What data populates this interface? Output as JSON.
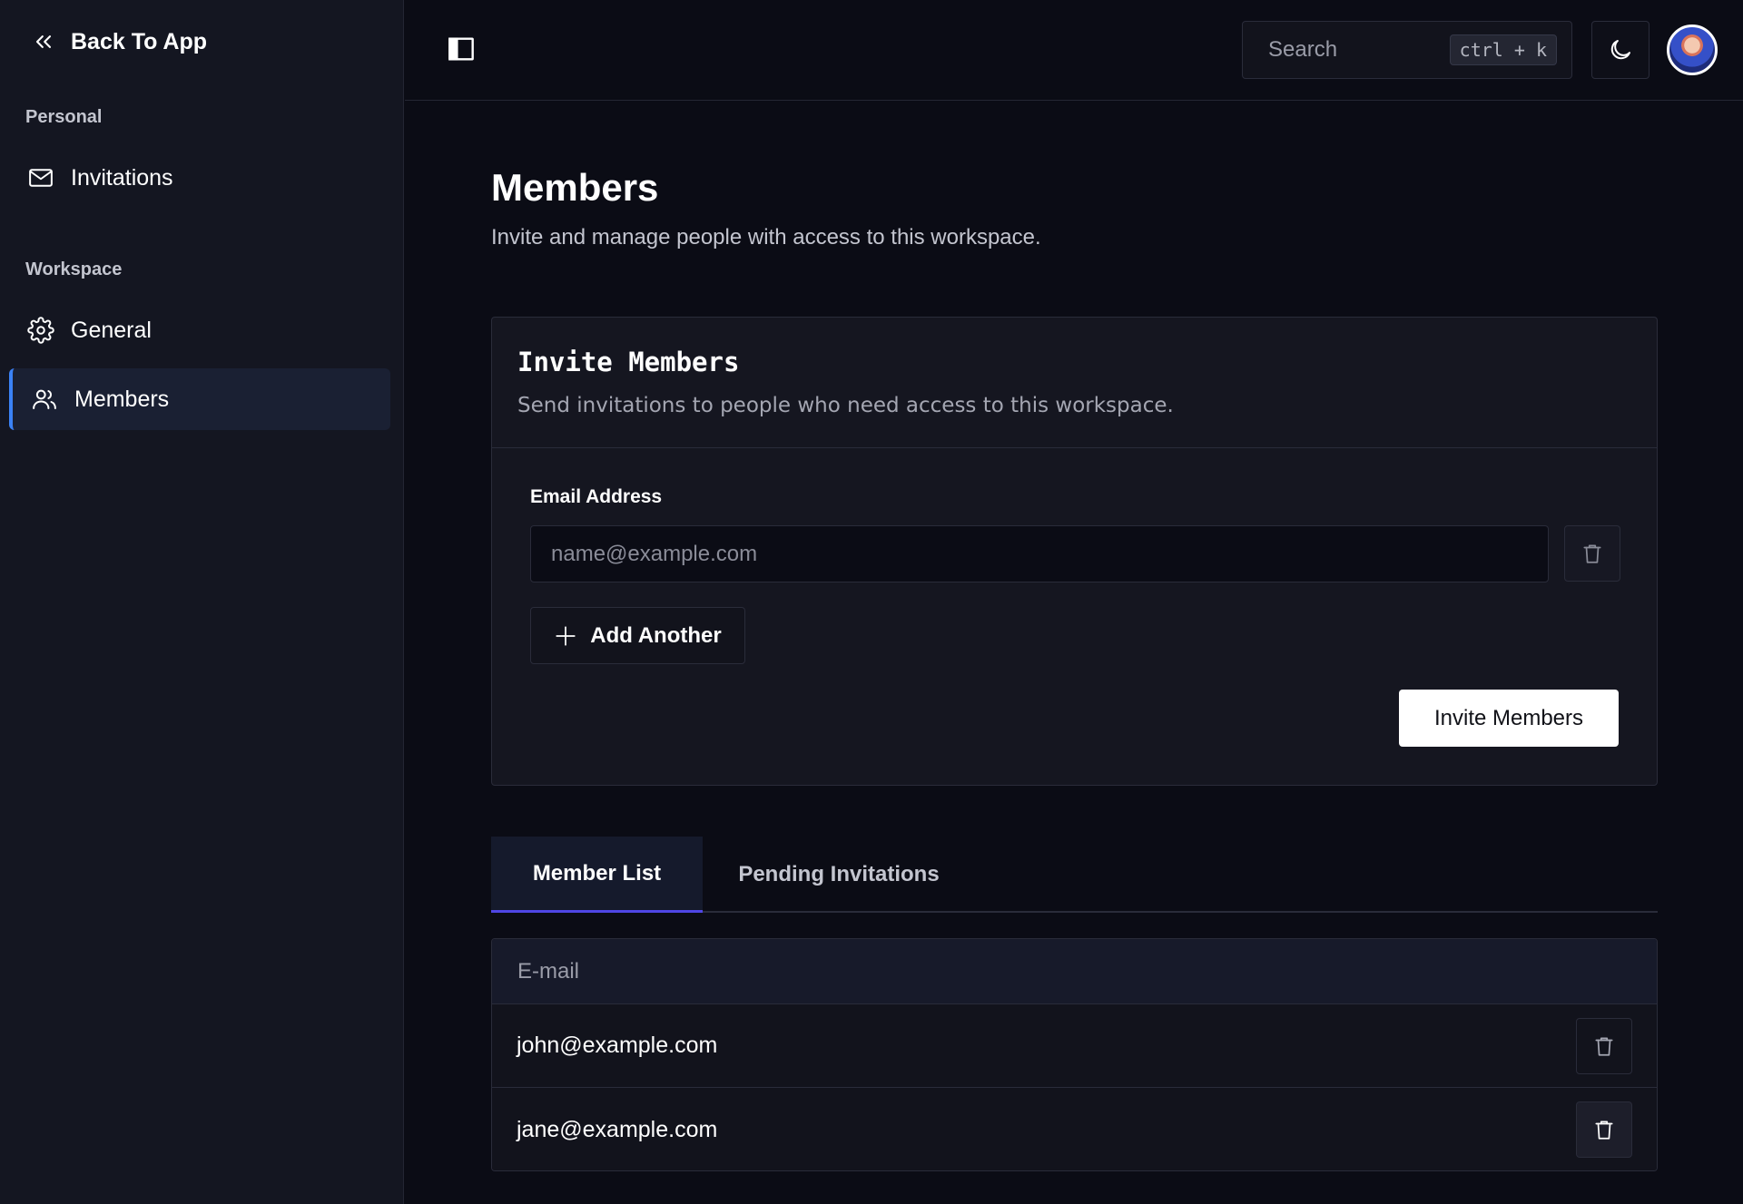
{
  "sidebar": {
    "back_label": "Back To App",
    "sections": [
      {
        "label": "Personal",
        "items": [
          {
            "label": "Invitations",
            "icon": "mail-icon"
          }
        ]
      },
      {
        "label": "Workspace",
        "items": [
          {
            "label": "General",
            "icon": "gear-icon"
          },
          {
            "label": "Members",
            "icon": "users-icon",
            "active": true
          }
        ]
      }
    ]
  },
  "topbar": {
    "search_label": "Search",
    "shortcut": "ctrl + k",
    "theme_icon": "moon-icon",
    "avatar": "user-avatar"
  },
  "page": {
    "title": "Members",
    "subtitle": "Invite and manage people with access to this workspace."
  },
  "invite": {
    "title": "Invite Members",
    "description": "Send invitations to people who need access to this workspace.",
    "field_label": "Email Address",
    "email_placeholder": "name@example.com",
    "email_value": "",
    "add_label": "Add Another",
    "submit_label": "Invite Members"
  },
  "tabs": [
    {
      "label": "Member List",
      "active": true
    },
    {
      "label": "Pending Invitations",
      "active": false
    }
  ],
  "table": {
    "header": "E-mail",
    "rows": [
      {
        "email": "john@example.com"
      },
      {
        "email": "jane@example.com"
      }
    ]
  },
  "colors": {
    "background": "#0b0c15",
    "sidebar": "#141621",
    "accent": "#3b82f6",
    "tab_indicator": "#4f46e5"
  }
}
